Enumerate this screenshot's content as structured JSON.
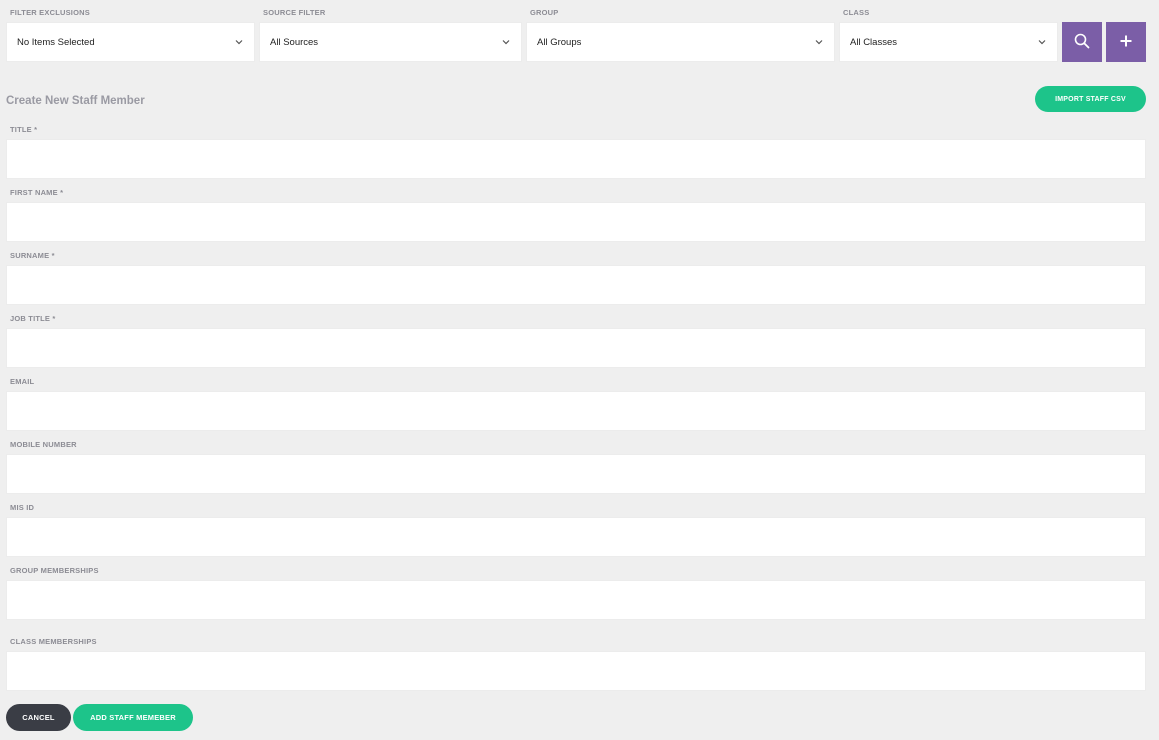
{
  "filters": {
    "exclusions": {
      "label": "FILTER EXCLUSIONS",
      "value": "No Items Selected"
    },
    "source": {
      "label": "SOURCE FILTER",
      "value": "All Sources"
    },
    "group": {
      "label": "GROUP",
      "value": "All Groups"
    },
    "class": {
      "label": "CLASS",
      "value": "All Classes"
    }
  },
  "toolbar": {
    "search_icon": "search-icon",
    "add_icon": "plus-icon",
    "accent_color": "#7b5ea7"
  },
  "form": {
    "title": "Create New Staff Member",
    "import_label": "IMPORT STAFF CSV",
    "fields": {
      "title": {
        "label": "TITLE *",
        "value": ""
      },
      "first_name": {
        "label": "FIRST NAME *",
        "value": ""
      },
      "surname": {
        "label": "SURNAME *",
        "value": ""
      },
      "job_title": {
        "label": "JOB TITLE *",
        "value": ""
      },
      "email": {
        "label": "EMAIL",
        "value": ""
      },
      "mobile": {
        "label": "MOBILE NUMBER",
        "value": ""
      },
      "mis_id": {
        "label": "MIS ID",
        "value": ""
      },
      "group_memberships": {
        "label": "GROUP MEMBERSHIPS",
        "value": ""
      },
      "class_memberships": {
        "label": "CLASS MEMBERSHIPS",
        "value": ""
      }
    },
    "cancel_label": "CANCEL",
    "submit_label": "ADD STAFF MEMEBER",
    "primary_color": "#1dc48a",
    "secondary_color": "#3a3d45"
  }
}
